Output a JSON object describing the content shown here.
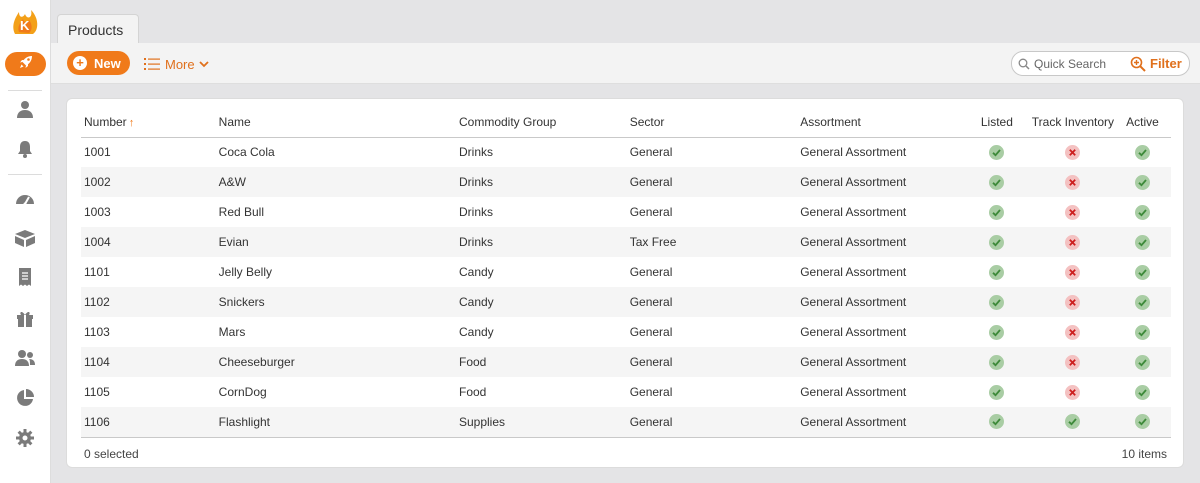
{
  "tab": {
    "label": "Products"
  },
  "toolbar": {
    "new_label": "New",
    "more_label": "More",
    "search_placeholder": "Quick Search",
    "filter_label": "Filter"
  },
  "colors": {
    "accent": "#f07a1a",
    "ok": "#a9cda4",
    "no": "#f4c1c1",
    "ok_mark": "#3e8a3a",
    "no_mark": "#cc1f1f"
  },
  "sidebar": {
    "icons": [
      "logo-icon",
      "rocket-icon",
      "user-icon",
      "bell-icon",
      "dashboard-icon",
      "boxes-icon",
      "receipt-icon",
      "gift-icon",
      "users-icon",
      "pie-chart-icon",
      "gear-icon"
    ]
  },
  "table": {
    "columns": [
      "Number",
      "Name",
      "Commodity Group",
      "Sector",
      "Assortment",
      "Listed",
      "Track Inventory",
      "Active"
    ],
    "sort_indicator": "↑",
    "rows": [
      {
        "number": "1001",
        "name": "Coca Cola",
        "group": "Drinks",
        "sector": "General",
        "assortment": "General Assortment",
        "listed": true,
        "track": false,
        "active": true
      },
      {
        "number": "1002",
        "name": "A&W",
        "group": "Drinks",
        "sector": "General",
        "assortment": "General Assortment",
        "listed": true,
        "track": false,
        "active": true
      },
      {
        "number": "1003",
        "name": "Red Bull",
        "group": "Drinks",
        "sector": "General",
        "assortment": "General Assortment",
        "listed": true,
        "track": false,
        "active": true
      },
      {
        "number": "1004",
        "name": "Evian",
        "group": "Drinks",
        "sector": "Tax Free",
        "assortment": "General Assortment",
        "listed": true,
        "track": false,
        "active": true
      },
      {
        "number": "1101",
        "name": "Jelly Belly",
        "group": "Candy",
        "sector": "General",
        "assortment": "General Assortment",
        "listed": true,
        "track": false,
        "active": true
      },
      {
        "number": "1102",
        "name": "Snickers",
        "group": "Candy",
        "sector": "General",
        "assortment": "General Assortment",
        "listed": true,
        "track": false,
        "active": true
      },
      {
        "number": "1103",
        "name": "Mars",
        "group": "Candy",
        "sector": "General",
        "assortment": "General Assortment",
        "listed": true,
        "track": false,
        "active": true
      },
      {
        "number": "1104",
        "name": "Cheeseburger",
        "group": "Food",
        "sector": "General",
        "assortment": "General Assortment",
        "listed": true,
        "track": false,
        "active": true
      },
      {
        "number": "1105",
        "name": "CornDog",
        "group": "Food",
        "sector": "General",
        "assortment": "General Assortment",
        "listed": true,
        "track": false,
        "active": true
      },
      {
        "number": "1106",
        "name": "Flashlight",
        "group": "Supplies",
        "sector": "General",
        "assortment": "General Assortment",
        "listed": true,
        "track": true,
        "active": true
      }
    ]
  },
  "footer": {
    "selected": "0 selected",
    "count": "10 items"
  }
}
